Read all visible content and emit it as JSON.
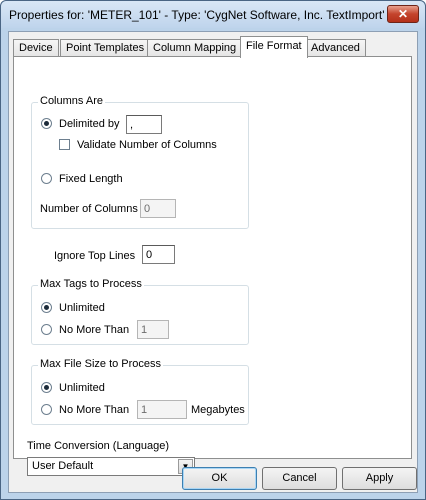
{
  "window": {
    "title": "Properties for: 'METER_101' - Type: 'CygNet Software, Inc. TextImport'",
    "close_glyph": "✕"
  },
  "tabs": [
    {
      "label": "Device"
    },
    {
      "label": "Point Templates"
    },
    {
      "label": "Column Mapping"
    },
    {
      "label": "File Format",
      "active": true
    },
    {
      "label": "Advanced"
    }
  ],
  "columns_are": {
    "title": "Columns Are",
    "delimited_label": "Delimited by",
    "delimiter_value": ",",
    "validate_label": "Validate Number of Columns",
    "fixed_length_label": "Fixed Length",
    "num_columns_label": "Number of Columns",
    "num_columns_value": "0",
    "selected": "delimited"
  },
  "ignore_top_lines": {
    "label": "Ignore Top Lines",
    "value": "0"
  },
  "max_tags": {
    "title": "Max Tags to Process",
    "unlimited_label": "Unlimited",
    "no_more_than_label": "No More Than",
    "value": "1",
    "selected": "unlimited"
  },
  "max_file_size": {
    "title": "Max File Size to Process",
    "unlimited_label": "Unlimited",
    "no_more_than_label": "No More Than",
    "value": "1",
    "unit_label": "Megabytes",
    "selected": "unlimited"
  },
  "time_conversion": {
    "label": "Time Conversion (Language)",
    "selected": "User Default"
  },
  "buttons": {
    "ok": "OK",
    "cancel": "Cancel",
    "apply": "Apply"
  }
}
